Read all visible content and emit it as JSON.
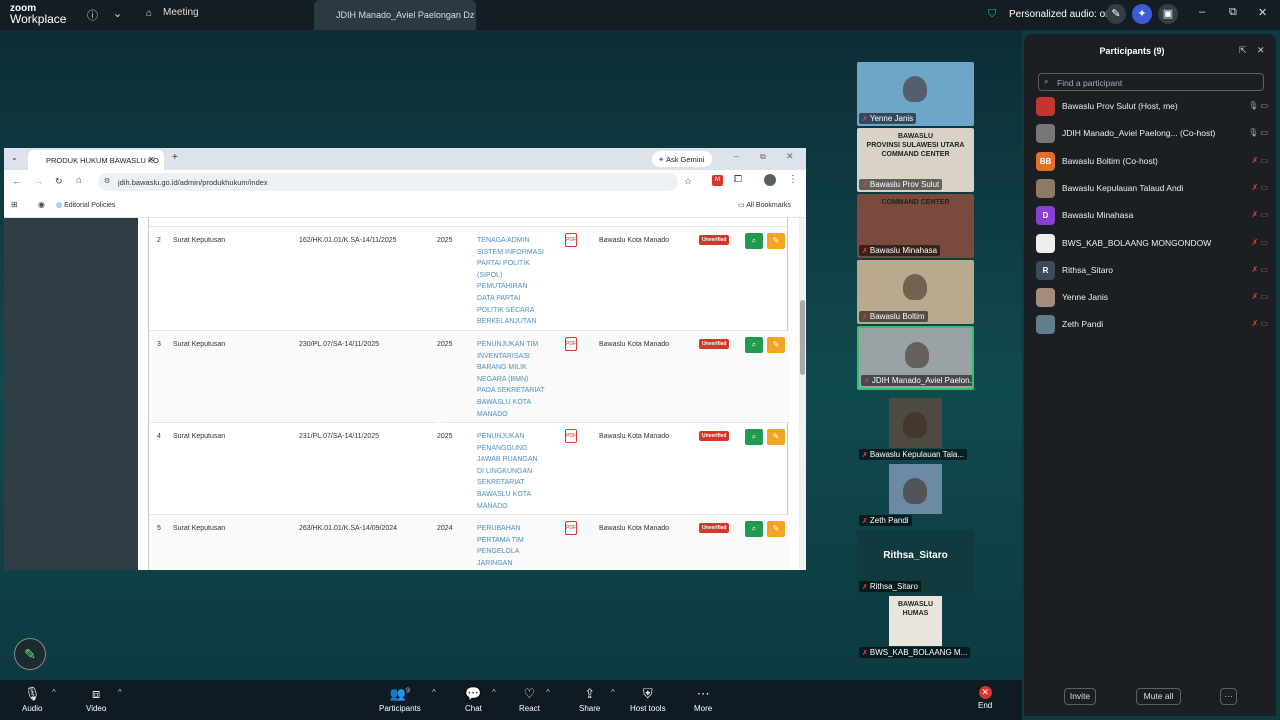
{
  "app": {
    "brand_line1": "zoom",
    "brand_line2": "Workplace",
    "meeting_tab": "Meeting",
    "active_tab": "JDIH Manado_Aviel Paelongan Dz",
    "audio_label": "Personalized audio: on"
  },
  "browser": {
    "tab_title": "PRODUK HUKUM BAWASLU KO",
    "url": "jdih.bawaslu.go.id/admin/produkhukum/index",
    "ask_gemini": "Ask Gemini",
    "bookmark": "Editorial Policies",
    "all_bookmarks": "All Bookmarks",
    "rows": [
      {
        "no": "2",
        "type": "Surat Keputusan",
        "number": "162/HK.01.01/K.SA-14/11/2025",
        "year": "2025",
        "title": [
          "TENAGA ADMIN",
          "SISTEM INFORMASI",
          "PARTAI POLITIK",
          "(SIPOL)",
          "PEMUTAHIRAN",
          "DATA PARTAI",
          "POLITIK SECARA",
          "BERKELANJUTAN"
        ],
        "org": "Bawaslu Kota Manado",
        "status": "Unverified"
      },
      {
        "no": "3",
        "type": "Surat Keputusan",
        "number": "230/PL.07/SA-14/11/2025",
        "year": "2025",
        "title": [
          "PENUNJUKAN TIM",
          "INVENTARISASI",
          "BARANG MILIK",
          "NEGARA (BMN)",
          "PADA SEKRETARIAT",
          "BAWASLU KOTA",
          "MANADO"
        ],
        "org": "Bawaslu Kota Manado",
        "status": "Unverified"
      },
      {
        "no": "4",
        "type": "Surat Keputusan",
        "number": "231/PL.07/SA-14/11/2025",
        "year": "2025",
        "title": [
          "PENUNJUKAN",
          "PENANGGUNG",
          "JAWAB RUANGAN",
          "DI LINGKUNGAN",
          "SEKRETARIAT",
          "BAWASLU KOTA",
          "MANADO"
        ],
        "org": "Bawaslu Kota Manado",
        "status": "Unverified"
      },
      {
        "no": "5",
        "type": "Surat Keputusan",
        "number": "263/HK.01.01/K.SA-14/09/2024",
        "year": "2024",
        "title": [
          "PERUBAHAN",
          "PERTAMA TIM",
          "PENGELOLA",
          "JARINGAN"
        ],
        "org": "Bawaslu Kota Manado",
        "status": "Unverified"
      }
    ]
  },
  "videos": [
    {
      "label": "Yenne Janis",
      "bg": "#6fa5c9"
    },
    {
      "label": "Bawaslu Prov Sulut",
      "bg": "#d8d2c8",
      "overlay": [
        "BAWASLU",
        "PROVINSI SULAWESI UTARA",
        "COMMAND CENTER"
      ]
    },
    {
      "label": "Bawaslu Minahasa",
      "bg": "#7a4a3c",
      "overlay": [
        "COMMAND CENTER"
      ]
    },
    {
      "label": "Bawaslu Boltim",
      "bg": "#b9a98f"
    },
    {
      "label": "JDIH Manado_Aviel Paelon...",
      "bg": "#9aa2a6"
    },
    {
      "label": "Bawaslu Kepulauan Tala...",
      "bg": "#4e4a42"
    },
    {
      "label": "Zeth Pandi",
      "bg": "#6c8aa3"
    },
    {
      "label": "Rithsa_Sitaro",
      "bg": "#0f3a3e",
      "name": "Rithsa_Sitaro"
    },
    {
      "label": "BWS_KAB_BOLAANG M...",
      "bg": "#e9e4dc",
      "overlay": [
        "BAWASLU",
        "HUMAS"
      ]
    }
  ],
  "panel": {
    "title": "Participants (9)",
    "search_placeholder": "Find a participant",
    "participants": [
      {
        "name": "Bawaslu Prov Sulut (Host, me)",
        "initial": "",
        "color": "#c4362b"
      },
      {
        "name": "JDIH Manado_Aviel Paelong... (Co-host)",
        "initial": "",
        "color": "#777"
      },
      {
        "name": "Bawaslu Boltim (Co-host)",
        "initial": "BB",
        "color": "#e0702a"
      },
      {
        "name": "Bawaslu Kepulauan Talaud Andi",
        "initial": "",
        "color": "#8d7a64"
      },
      {
        "name": "Bawaslu Minahasa",
        "initial": "D",
        "color": "#8a3fd1"
      },
      {
        "name": "BWS_KAB_BOLAANG MONGONDOW",
        "initial": "",
        "color": "#eee"
      },
      {
        "name": "Rithsa_Sitaro",
        "initial": "R",
        "color": "#3c4b5c"
      },
      {
        "name": "Yenne Janis",
        "initial": "",
        "color": "#a48b7a"
      },
      {
        "name": "Zeth Pandi",
        "initial": "",
        "color": "#607d8b"
      }
    ],
    "invite": "Invite",
    "mute_all": "Mute all",
    "more": "···"
  },
  "toolbar": {
    "audio": "Audio",
    "video": "Video",
    "participants": "Participants",
    "participants_count": "9",
    "chat": "Chat",
    "react": "React",
    "share": "Share",
    "host_tools": "Host tools",
    "more": "More",
    "end": "End"
  }
}
